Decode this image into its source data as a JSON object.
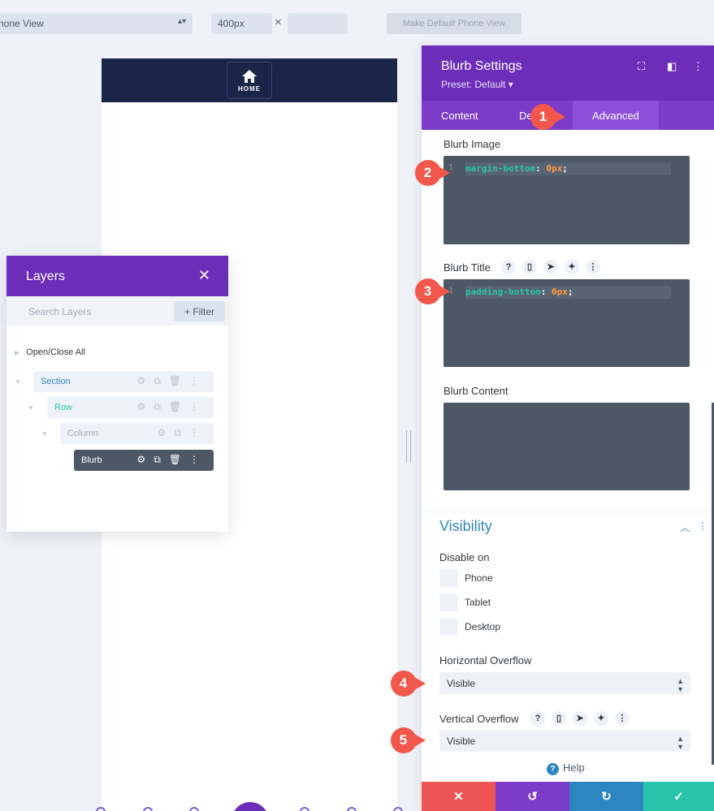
{
  "toolbar": {
    "view_select": "hone View",
    "width_value": "400px",
    "times": "×",
    "default_button": "Make Default Phone View"
  },
  "preview": {
    "home_label": "HOME"
  },
  "layers": {
    "title": "Layers",
    "search_placeholder": "Search Layers",
    "filter_label": "+ Filter",
    "open_close_all": "Open/Close All",
    "items": [
      {
        "label": "Section"
      },
      {
        "label": "Row"
      },
      {
        "label": "Column"
      },
      {
        "label": "Blurb"
      }
    ]
  },
  "settings": {
    "title": "Blurb Settings",
    "preset": "Preset: Default ▾",
    "tabs": [
      "Content",
      "De",
      "Advanced"
    ],
    "blurb_image_label": "Blurb Image",
    "blurb_image_css": {
      "line_no": "1",
      "prop": "margin-bottom",
      "value": "0px"
    },
    "blurb_title_label": "Blurb Title",
    "blurb_title_css": {
      "line_no": "1",
      "prop": "padding-bottom",
      "value": "0px"
    },
    "blurb_content_label": "Blurb Content",
    "visibility_title": "Visibility",
    "disable_on_label": "Disable on",
    "disable_options": [
      "Phone",
      "Tablet",
      "Desktop"
    ],
    "horizontal_overflow_label": "Horizontal Overflow",
    "horizontal_overflow_value": "Visible",
    "vertical_overflow_label": "Vertical Overflow",
    "vertical_overflow_value": "Visible",
    "help_label": "Help"
  },
  "callouts": [
    "1",
    "2",
    "3",
    "4",
    "5"
  ],
  "colors": {
    "purple": "#6c2eb9",
    "cancel": "#ef5555",
    "undo": "#7d3cc8",
    "redo": "#2e86c1",
    "save": "#29c4a9",
    "marker": "#f1574a"
  },
  "icons": {
    "home": "home-icon",
    "close": "close-icon",
    "gear": "gear-icon",
    "duplicate": "duplicate-icon",
    "trash": "trash-icon",
    "more": "more-icon",
    "help": "question-icon",
    "check": "check-icon",
    "undo": "undo-icon",
    "redo": "redo-icon"
  }
}
